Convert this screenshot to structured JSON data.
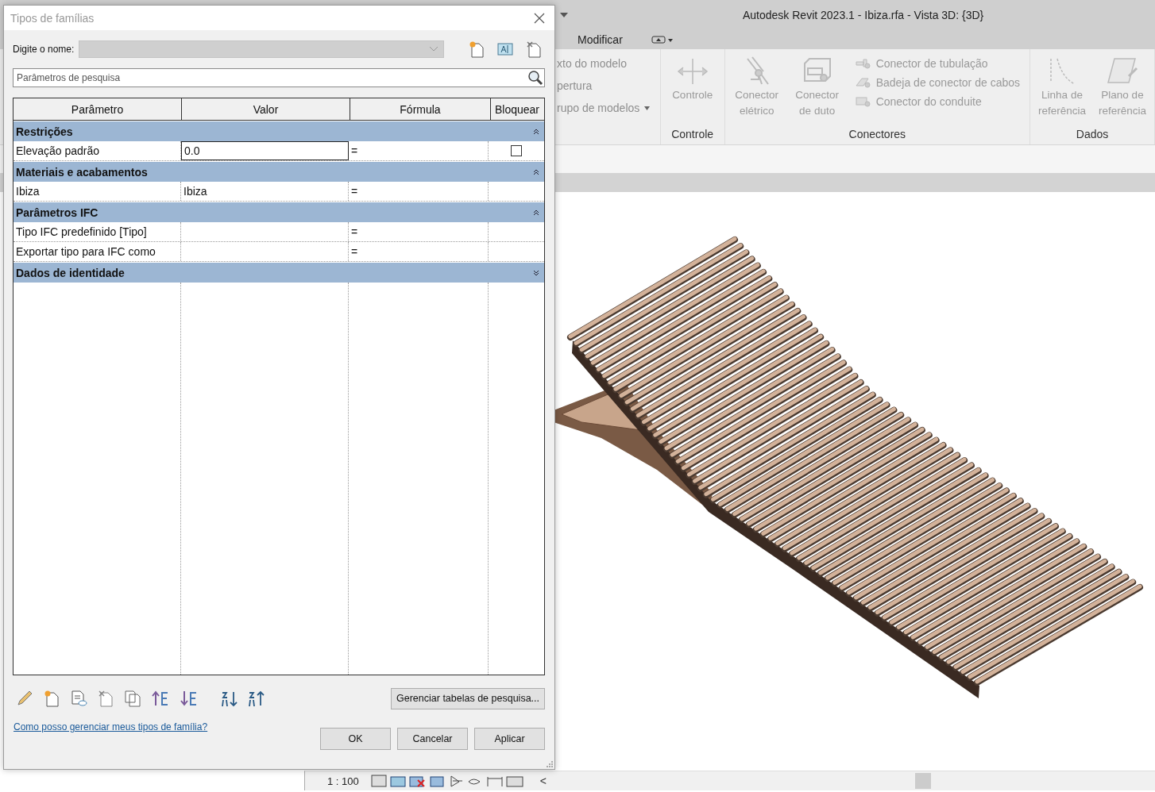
{
  "window": {
    "title": "Autodesk Revit 2023.1 - Ibiza.rfa - Vista 3D: {3D}"
  },
  "ribbon": {
    "tabs": [
      {
        "label": "Modificar",
        "selected": false
      }
    ],
    "left_panel": {
      "items": [
        {
          "label": "xto do modelo",
          "dropdown": false
        },
        {
          "label": "pertura",
          "dropdown": false
        },
        {
          "label": "rupo de modelos",
          "dropdown": true
        }
      ]
    },
    "panels": [
      {
        "title": "Controle",
        "large": [
          {
            "label": "Controle"
          }
        ]
      },
      {
        "title": "Conectores",
        "large": [
          {
            "label": "Conector elétrico"
          },
          {
            "label": "Conector de duto"
          }
        ],
        "small": [
          {
            "label": "Conector de tubulação"
          },
          {
            "label": "Badeja de conector de cabos"
          },
          {
            "label": "Conector do conduite"
          }
        ]
      },
      {
        "title": "Dados",
        "large": [
          {
            "label": "Linha de referência"
          },
          {
            "label": "Plano de referência"
          }
        ]
      }
    ]
  },
  "dialog": {
    "title": "Tipos de famílias",
    "name_label": "Digite o nome:",
    "search_placeholder": "Parâmetros de pesquisa",
    "columns": [
      "Parâmetro",
      "Valor",
      "Fórmula",
      "Bloquear"
    ],
    "groups": [
      {
        "name": "Restrições",
        "expanded": true,
        "rows": [
          {
            "parameter": "Elevação padrão",
            "value": "0.0",
            "editing": true,
            "formula": "=",
            "locked": false
          }
        ]
      },
      {
        "name": "Materiais e acabamentos",
        "expanded": true,
        "rows": [
          {
            "parameter": "Ibiza",
            "value": "Ibiza",
            "editing": false,
            "formula": "="
          }
        ]
      },
      {
        "name": "Parâmetros IFC",
        "expanded": true,
        "rows": [
          {
            "parameter": "Tipo IFC predefinido [Tipo]",
            "value": "",
            "editing": false,
            "formula": "="
          },
          {
            "parameter": "Exportar tipo para IFC como",
            "value": "",
            "editing": false,
            "formula": "="
          }
        ]
      },
      {
        "name": "Dados de identidade",
        "expanded": false
      }
    ],
    "lookup_button": "Gerenciar tabelas de pesquisa...",
    "help_link": "Como posso gerenciar meus tipos de família?",
    "buttons": [
      "OK",
      "Cancelar",
      "Aplicar"
    ]
  },
  "status_bar": {
    "scale": "1 : 100",
    "collapse": "<"
  }
}
